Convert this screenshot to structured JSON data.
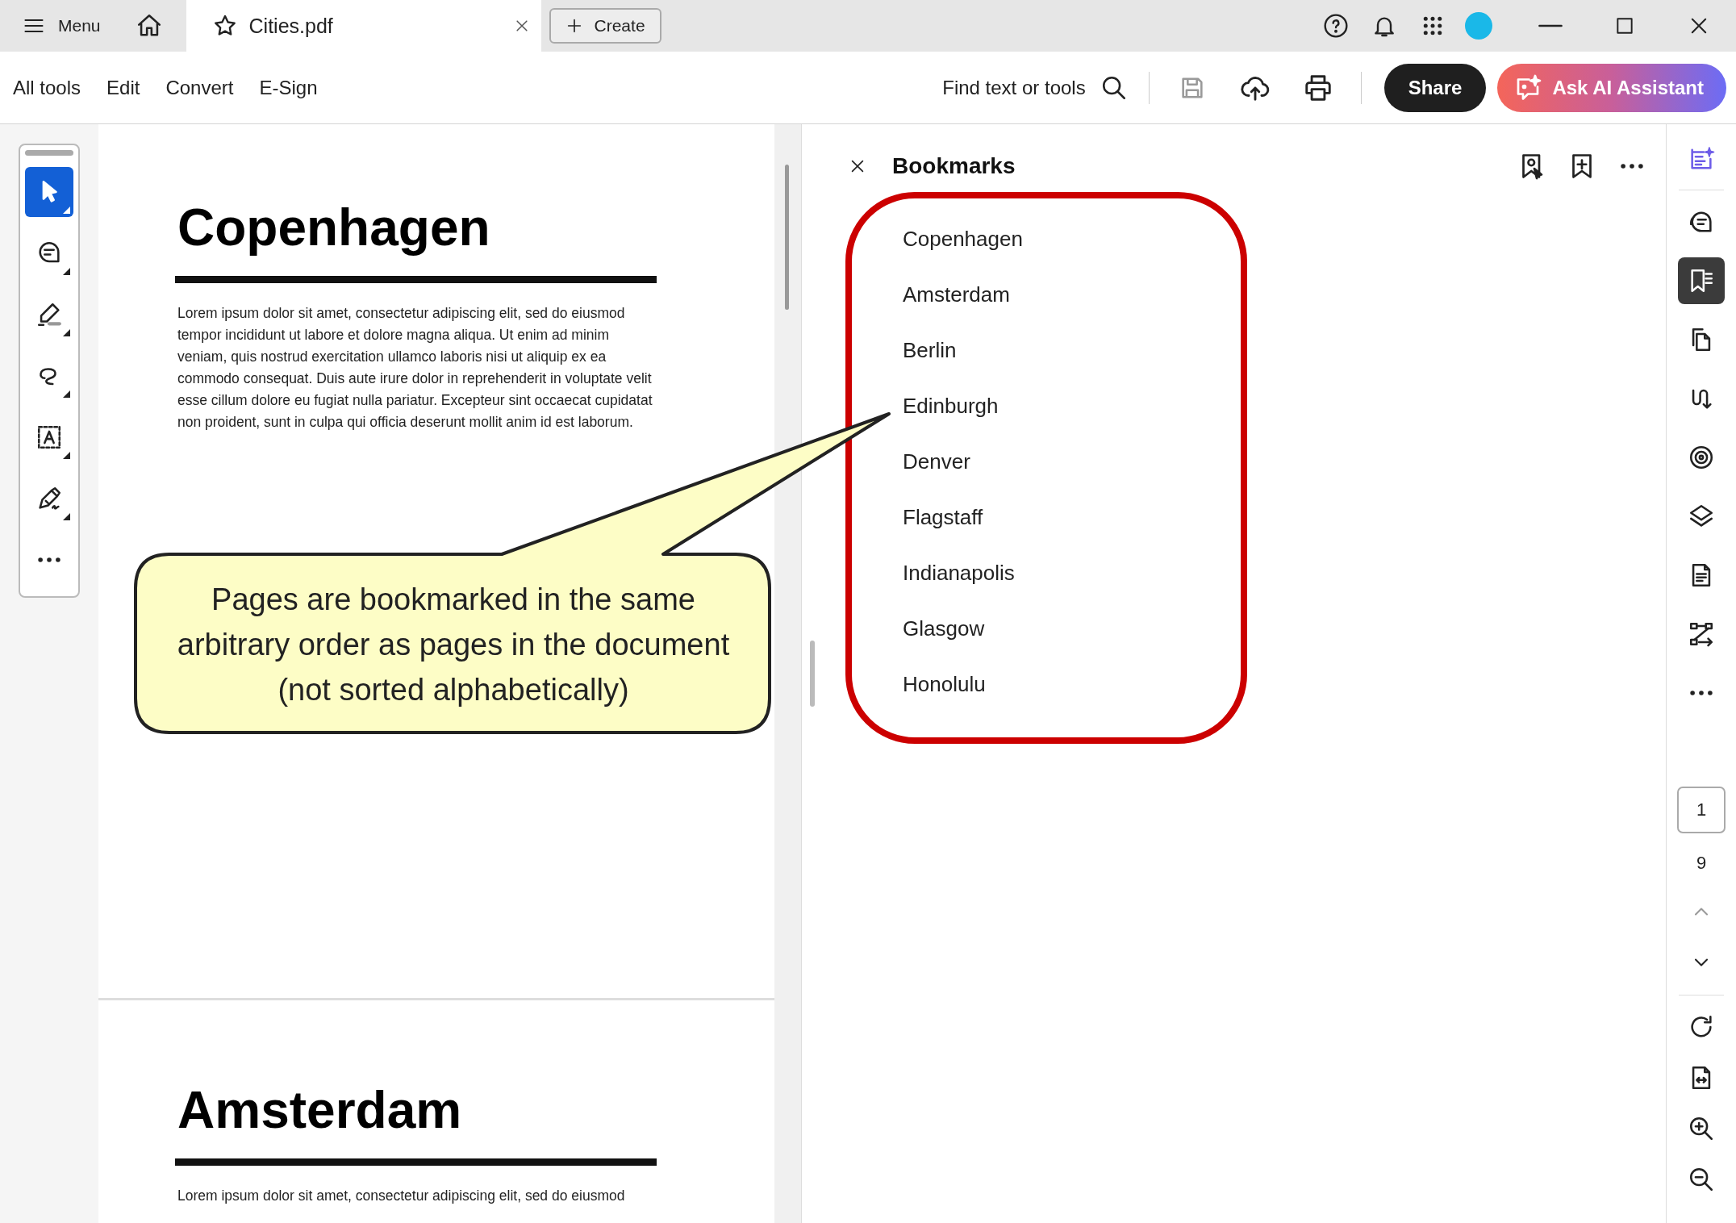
{
  "title_bar": {
    "menu_label": "Menu",
    "tab_title": "Cities.pdf",
    "create_label": "Create"
  },
  "toolbar": {
    "menus": [
      "All tools",
      "Edit",
      "Convert",
      "E-Sign"
    ],
    "search_label": "Find text or tools",
    "share_label": "Share",
    "ai_label": "Ask AI Assistant"
  },
  "left_tools": [
    {
      "kind": "select",
      "selected": true
    },
    {
      "kind": "comment",
      "selected": false
    },
    {
      "kind": "highlight",
      "selected": false
    },
    {
      "kind": "draw",
      "selected": false
    },
    {
      "kind": "text",
      "selected": false
    },
    {
      "kind": "sign",
      "selected": false
    },
    {
      "kind": "more",
      "selected": false
    }
  ],
  "document": {
    "pages": [
      {
        "heading": "Copenhagen",
        "body": "Lorem ipsum dolor sit amet, consectetur adipiscing elit, sed do eiusmod tempor incididunt ut labore et dolore magna aliqua. Ut enim ad minim veniam, quis nostrud exercitation ullamco laboris nisi ut aliquip ex ea commodo consequat. Duis aute irure dolor in reprehenderit in voluptate velit esse cillum dolore eu fugiat nulla pariatur. Excepteur sint occaecat cupidatat non proident, sunt in culpa qui officia deserunt mollit anim id est laborum."
      },
      {
        "heading": "Amsterdam",
        "body": "Lorem ipsum dolor sit amet, consectetur adipiscing elit, sed do eiusmod"
      }
    ]
  },
  "callout": {
    "text": "Pages are bookmarked in the same arbitrary order as pages in the document (not sorted alphabetically)"
  },
  "bookmarks": {
    "title": "Bookmarks",
    "items": [
      "Copenhagen",
      "Amsterdam",
      "Berlin",
      "Edinburgh",
      "Denver",
      "Flagstaff",
      "Indianapolis",
      "Glasgow",
      "Honolulu"
    ]
  },
  "right_rail": {
    "tools": [
      {
        "kind": "ai",
        "selected": false
      },
      {
        "kind": "comments",
        "selected": false
      },
      {
        "kind": "bookmarks",
        "selected": true
      },
      {
        "kind": "pages",
        "selected": false
      },
      {
        "kind": "combine",
        "selected": false
      },
      {
        "kind": "stamp",
        "selected": false
      },
      {
        "kind": "layers",
        "selected": false
      },
      {
        "kind": "document",
        "selected": false
      },
      {
        "kind": "compare",
        "selected": false
      },
      {
        "kind": "more",
        "selected": false
      }
    ],
    "page_number": "1",
    "page_count": "9"
  }
}
